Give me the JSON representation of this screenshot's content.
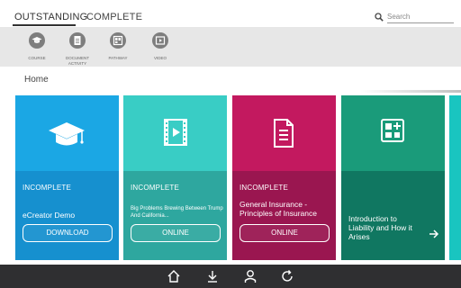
{
  "tabs": [
    {
      "label": "OUTSTANDING",
      "active": true
    },
    {
      "label": "COMPLETE",
      "active": false
    }
  ],
  "search": {
    "placeholder": "Search",
    "icon": "search-icon"
  },
  "filters": [
    {
      "label": "COURSE",
      "icon": "graduation-cap-icon"
    },
    {
      "label": "DOCUMENT ACTIVITY",
      "icon": "document-icon"
    },
    {
      "label": "PATHWAY",
      "icon": "pathway-icon"
    },
    {
      "label": "VIDEO",
      "icon": "video-icon"
    }
  ],
  "breadcrumb": {
    "label": "Home"
  },
  "cards": [
    {
      "status": "INCOMPLETE",
      "title": "eCreator Demo",
      "button": "DOWNLOAD",
      "icon": "graduation-cap-icon",
      "color_top": "#1ba7e4",
      "color_bottom": "#1690cf"
    },
    {
      "status": "INCOMPLETE",
      "title": "Big Problems Brewing Between Trump And California...",
      "button": "ONLINE",
      "icon": "video-icon",
      "color_top": "#39cdc5",
      "color_bottom": "#2ea79f"
    },
    {
      "status": "INCOMPLETE",
      "title": "General Insurance - Principles of Insurance",
      "button": "ONLINE",
      "icon": "document-icon",
      "color_top": "#c3195f",
      "color_bottom": "#9a1650"
    },
    {
      "title": "Introduction to Liability and How it Arises",
      "icon": "pathway-icon",
      "action_icon": "arrow-right-icon",
      "color_top": "#1a9b7a",
      "color_bottom": "#107761"
    }
  ],
  "bottom_nav": [
    {
      "icon": "home-icon"
    },
    {
      "icon": "download-icon"
    },
    {
      "icon": "user-icon"
    },
    {
      "icon": "refresh-icon"
    }
  ]
}
